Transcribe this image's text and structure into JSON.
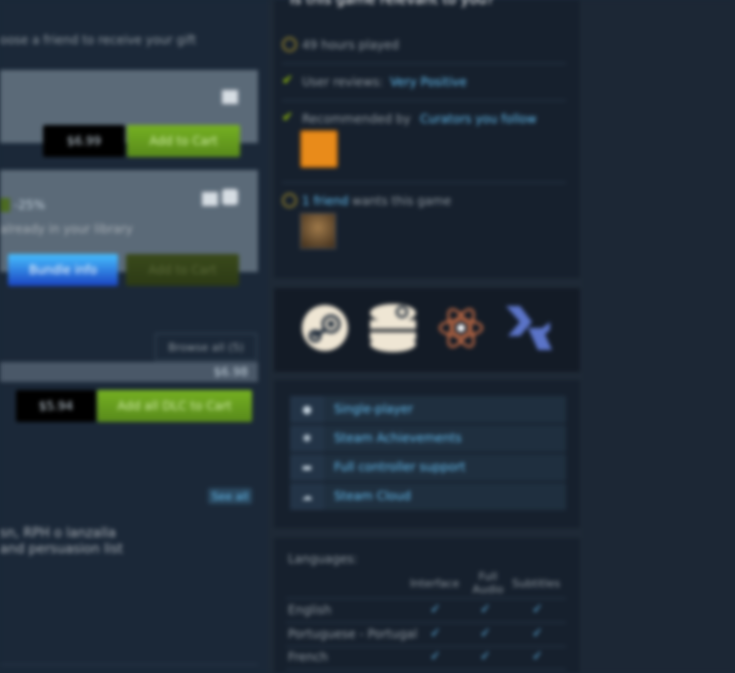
{
  "left": {
    "gift_text": "oose a friend to receive your gift",
    "item1": {
      "price": "$6.99",
      "add_to_cart": "Add to Cart"
    },
    "item2": {
      "badge": "-25%",
      "owned_text": "already in your library",
      "bundle_info": "Bundle info",
      "add_to_cart": "Add to Cart"
    },
    "dlc": {
      "browse_all": "Browse all (5)",
      "total": "$6.98",
      "bundle_price": "$5.94",
      "add_all": "Add all DLC to Cart"
    },
    "see_all": "See all",
    "desc_line1": "sn, RPH o lanzalla",
    "desc_line2": "and persuasion list"
  },
  "relevant": {
    "title": "Is this game relevant to you?",
    "hours": "49 hours played",
    "reviews_prefix": "User reviews:",
    "reviews_value": "Very Positive",
    "recommended_prefix": "Recommended by",
    "recommended_name": "Curators you follow",
    "friend_count": "1 friend",
    "friend_suffix": "wants this game"
  },
  "platforms": {
    "icons": [
      "steam-icon",
      "steam-db-icon",
      "atom-icon",
      "kodi-icon"
    ]
  },
  "features": [
    {
      "icon": "person-icon",
      "label": "Single-player"
    },
    {
      "icon": "star-icon",
      "label": "Steam Achievements"
    },
    {
      "icon": "gamepad-icon",
      "label": "Full controller support"
    },
    {
      "icon": "cloud-icon",
      "label": "Steam Cloud"
    }
  ],
  "languages": {
    "title": "Languages:",
    "columns": [
      "Interface",
      "Full Audio",
      "Subtitles"
    ],
    "rows": [
      {
        "name": "English"
      },
      {
        "name": "Portuguese - Portugal"
      },
      {
        "name": "French"
      }
    ]
  }
}
